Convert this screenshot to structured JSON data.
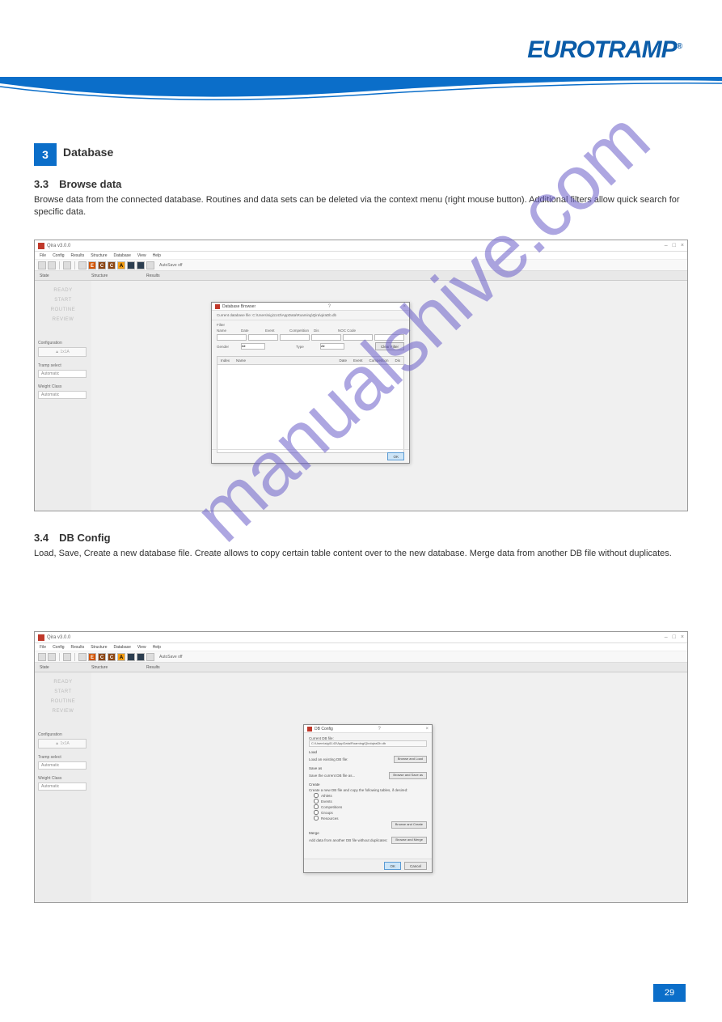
{
  "logo": "EUROTRAMP",
  "logo_r": "®",
  "section": {
    "num": "3",
    "label": "Database"
  },
  "sub_a": {
    "heading": "3.3 Browse data",
    "text": "Browse data from the connected database. Routines and data sets can be deleted via the context menu (right mouse button). Additional filters allow quick search for specific data."
  },
  "sub_b": {
    "heading": "3.4 DB Config",
    "text": "Load, Save, Create a new database file. Create allows to copy certain table content over to the new database. Merge data from another DB file without duplicates."
  },
  "titlebar": {
    "app": "Qira v3.0.0",
    "close": "×",
    "min": "–",
    "max": "□"
  },
  "menubar": [
    "File",
    "Config",
    "Results",
    "Structure",
    "Database",
    "View",
    "Help"
  ],
  "autosave": "AutoSave off",
  "col_headers": {
    "state": "State",
    "structure": "Structure",
    "results": "Results"
  },
  "states": [
    "READY",
    "START",
    "ROUTINE",
    "REVIEW"
  ],
  "config_group": {
    "label": "Configuration",
    "btn": "▲ 1x1A"
  },
  "tramp": {
    "label": "Tramp select",
    "value": "Automatic"
  },
  "weight": {
    "label": "Weight Class",
    "value": "Automatic"
  },
  "dlg_browser": {
    "title": "Database Browser",
    "path_label": "Current database file:",
    "path": "C:\\Users\\sigi1143\\AppData\\Roaming\\Qira\\qiraDb.db",
    "filter_label": "Filter",
    "cols": {
      "name": "Name",
      "date": "Date",
      "event": "Event",
      "competition": "Competition",
      "dis": "Dis",
      "noc": "NOC Code"
    },
    "gender_label": "Gender",
    "gender_value": "All",
    "type_label": "Type",
    "type_value": "All",
    "clear": "Clear Filter",
    "table_cols": {
      "index": "Index",
      "name": "Name",
      "date": "Date",
      "event": "Event",
      "competition": "Competition",
      "dis": "Dis"
    },
    "ok": "OK"
  },
  "dlg_config": {
    "title": "DB Config",
    "current_label": "Current DB file:",
    "current_path": "C:\\Users\\sigi1143\\AppData\\Roaming\\Qira\\qiraDb.db",
    "load_section": "Load",
    "load_text": "Load an existing DB file:",
    "load_btn": "Browse and Load",
    "save_section": "Save as",
    "save_text": "Save the current DB file as...",
    "save_btn": "Browse and Save as",
    "create_section": "Create",
    "create_text": "Create a new DB file and copy the following tables, if desired:",
    "checks": [
      "Athlets",
      "Events",
      "Competitions",
      "Groups",
      "Resources"
    ],
    "create_btn": "Browse and Create",
    "merge_section": "Merge",
    "merge_text": "Add data from another DB file without duplicates:",
    "merge_btn": "Browse and Merge",
    "ok": "OK",
    "cancel": "Cancel"
  },
  "watermark": "manualshive.com",
  "page": "29"
}
